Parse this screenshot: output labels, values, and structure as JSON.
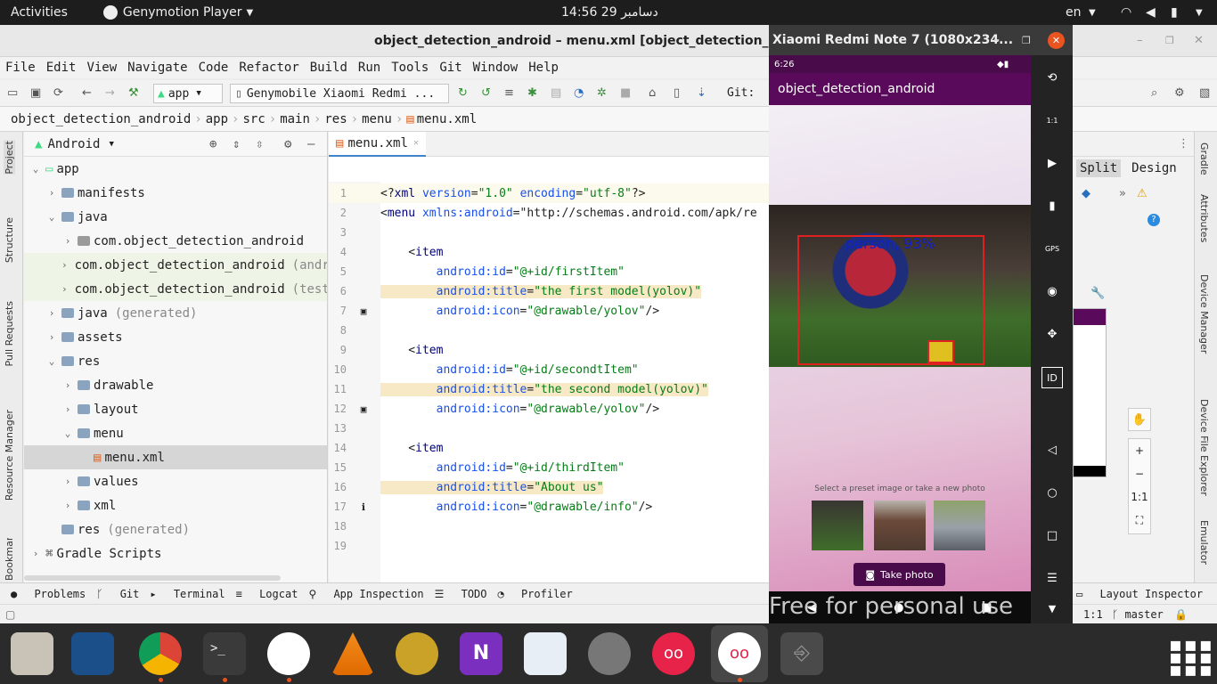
{
  "topbar": {
    "activities": "Activities",
    "app": "Genymotion Player",
    "clock": "14:56  29 دسامبر",
    "lang": "en"
  },
  "window": {
    "title": "object_detection_android – menu.xml [object_detection_andro"
  },
  "menu": [
    "File",
    "Edit",
    "View",
    "Navigate",
    "Code",
    "Refactor",
    "Build",
    "Run",
    "Tools",
    "Git",
    "Window",
    "Help"
  ],
  "toolbar": {
    "module": "app",
    "device": "Genymobile Xiaomi Redmi ...",
    "git_label": "Git:"
  },
  "breadcrumb": [
    "object_detection_android",
    "app",
    "src",
    "main",
    "res",
    "menu",
    "menu.xml"
  ],
  "left_tabs": [
    "Project",
    "Structure",
    "Pull Requests",
    "Resource Manager",
    "Bookmarks"
  ],
  "project": {
    "view": "Android",
    "tree": [
      {
        "label": "app",
        "suffix": "",
        "depth": 0,
        "open": true,
        "kind": "module"
      },
      {
        "label": "manifests",
        "suffix": "",
        "depth": 1,
        "open": false,
        "kind": "folder"
      },
      {
        "label": "java",
        "suffix": "",
        "depth": 1,
        "open": true,
        "kind": "folder"
      },
      {
        "label": "com.object_detection_android",
        "suffix": "",
        "depth": 2,
        "open": false,
        "kind": "package"
      },
      {
        "label": "com.object_detection_android",
        "suffix": "(andr",
        "depth": 2,
        "open": false,
        "kind": "package"
      },
      {
        "label": "com.object_detection_android",
        "suffix": "(test)",
        "depth": 2,
        "open": false,
        "kind": "package"
      },
      {
        "label": "java",
        "suffix": "(generated)",
        "depth": 1,
        "open": false,
        "kind": "folder"
      },
      {
        "label": "assets",
        "suffix": "",
        "depth": 1,
        "open": false,
        "kind": "folder"
      },
      {
        "label": "res",
        "suffix": "",
        "depth": 1,
        "open": true,
        "kind": "folder"
      },
      {
        "label": "drawable",
        "suffix": "",
        "depth": 2,
        "open": false,
        "kind": "folder"
      },
      {
        "label": "layout",
        "suffix": "",
        "depth": 2,
        "open": false,
        "kind": "folder"
      },
      {
        "label": "menu",
        "suffix": "",
        "depth": 2,
        "open": true,
        "kind": "folder"
      },
      {
        "label": "menu.xml",
        "suffix": "",
        "depth": 3,
        "open": null,
        "kind": "file"
      },
      {
        "label": "values",
        "suffix": "",
        "depth": 2,
        "open": false,
        "kind": "folder"
      },
      {
        "label": "xml",
        "suffix": "",
        "depth": 2,
        "open": false,
        "kind": "folder"
      },
      {
        "label": "res",
        "suffix": "(generated)",
        "depth": 1,
        "open": null,
        "kind": "folder"
      },
      {
        "label": "Gradle Scripts",
        "suffix": "",
        "depth": 0,
        "open": false,
        "kind": "gradle"
      }
    ]
  },
  "editor": {
    "tab": "menu.xml",
    "lines": [
      "<?xml version=\"1.0\" encoding=\"utf-8\"?>",
      "<menu xmlns:android=\"http://schemas.android.com/apk/re",
      "",
      "    <item",
      "        android:id=\"@+id/firstItem\"",
      "        android:title=\"the first model(yolov)\"",
      "        android:icon=\"@drawable/yolov\"/>",
      "",
      "    <item",
      "        android:id=\"@+id/secondtItem\"",
      "        android:title=\"the second model(yolov)\"",
      "        android:icon=\"@drawable/yolov\"/>",
      "",
      "    <item",
      "        android:id=\"@+id/thirdItem\"",
      "        android:title=\"About us\"",
      "        android:icon=\"@drawable/info\"/>",
      "",
      ""
    ]
  },
  "right_ide": {
    "split": "Split",
    "design": "Design",
    "zoom_label": "1:1"
  },
  "right_tabs": [
    "Gradle",
    "Attributes",
    "Device Manager",
    "Device File Explorer",
    "Emulator"
  ],
  "bottom_tools": [
    "Problems",
    "Git",
    "Terminal",
    "Logcat",
    "App Inspection",
    "TODO",
    "Profiler",
    "Layout Inspector"
  ],
  "status": {
    "zoom": "1:1",
    "branch": "master"
  },
  "emulator": {
    "title": "Xiaomi Redmi Note 7 (1080x234...",
    "phone_time": "6:26",
    "app_title": "object_detection_android",
    "detection_label": "person, 93%",
    "prompt": "Select a preset image or take a new photo",
    "button": "Take photo",
    "watermark": "Free for personal use",
    "side_labels": {
      "scale": "1:1",
      "gps": "GPS",
      "id": "ID"
    }
  }
}
